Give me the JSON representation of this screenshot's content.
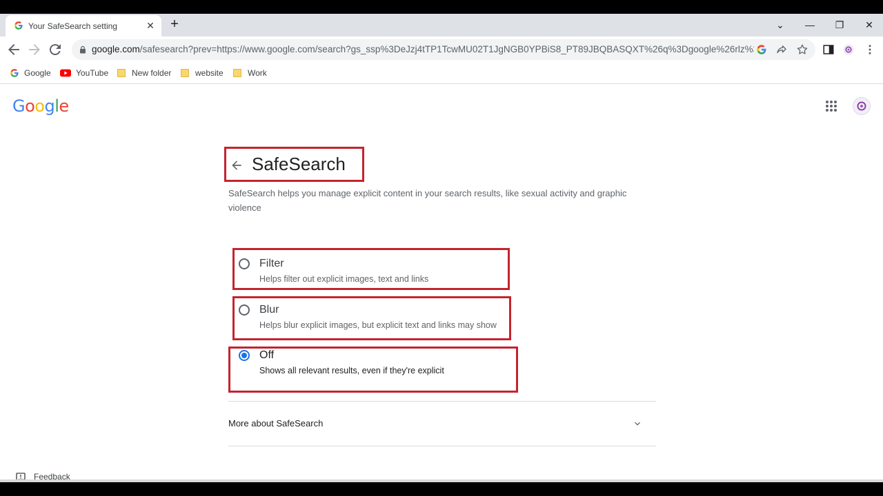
{
  "tab": {
    "title": "Your SafeSearch setting",
    "close": "✕",
    "new_tab": "+"
  },
  "window_controls": {
    "menu": "⌄",
    "minimize": "—",
    "restore": "❐",
    "close": "✕"
  },
  "address_bar": {
    "url_host": "google.com",
    "url_rest": "/safesearch?prev=https://www.google.com/search?gs_ssp%3DeJzj4tTP1TcwMU02T1JgNGB0YPBiS8_PT89JBQBASQXT%26q%3Dgoogle%26rlz%3D1C1C..."
  },
  "bookmarks": [
    {
      "label": "Google",
      "icon": "google-icon"
    },
    {
      "label": "YouTube",
      "icon": "youtube-icon"
    },
    {
      "label": "New folder",
      "icon": "folder-icon"
    },
    {
      "label": "website",
      "icon": "folder-icon"
    },
    {
      "label": "Work",
      "icon": "folder-icon"
    }
  ],
  "header": {
    "logo": "Google"
  },
  "main": {
    "title": "SafeSearch",
    "description": "SafeSearch helps you manage explicit content in your search results, like sexual activity and graphic violence",
    "options": [
      {
        "label": "Filter",
        "sublabel": "Helps filter out explicit images, text and links",
        "selected": false
      },
      {
        "label": "Blur",
        "sublabel": "Helps blur explicit images, but explicit text and links may show",
        "selected": false
      },
      {
        "label": "Off",
        "sublabel": "Shows all relevant results, even if they're explicit",
        "selected": true
      }
    ],
    "more_label": "More about SafeSearch"
  },
  "footer": {
    "feedback": "Feedback"
  },
  "colors": {
    "highlight": "#c5232e",
    "accent": "#1a73e8"
  }
}
